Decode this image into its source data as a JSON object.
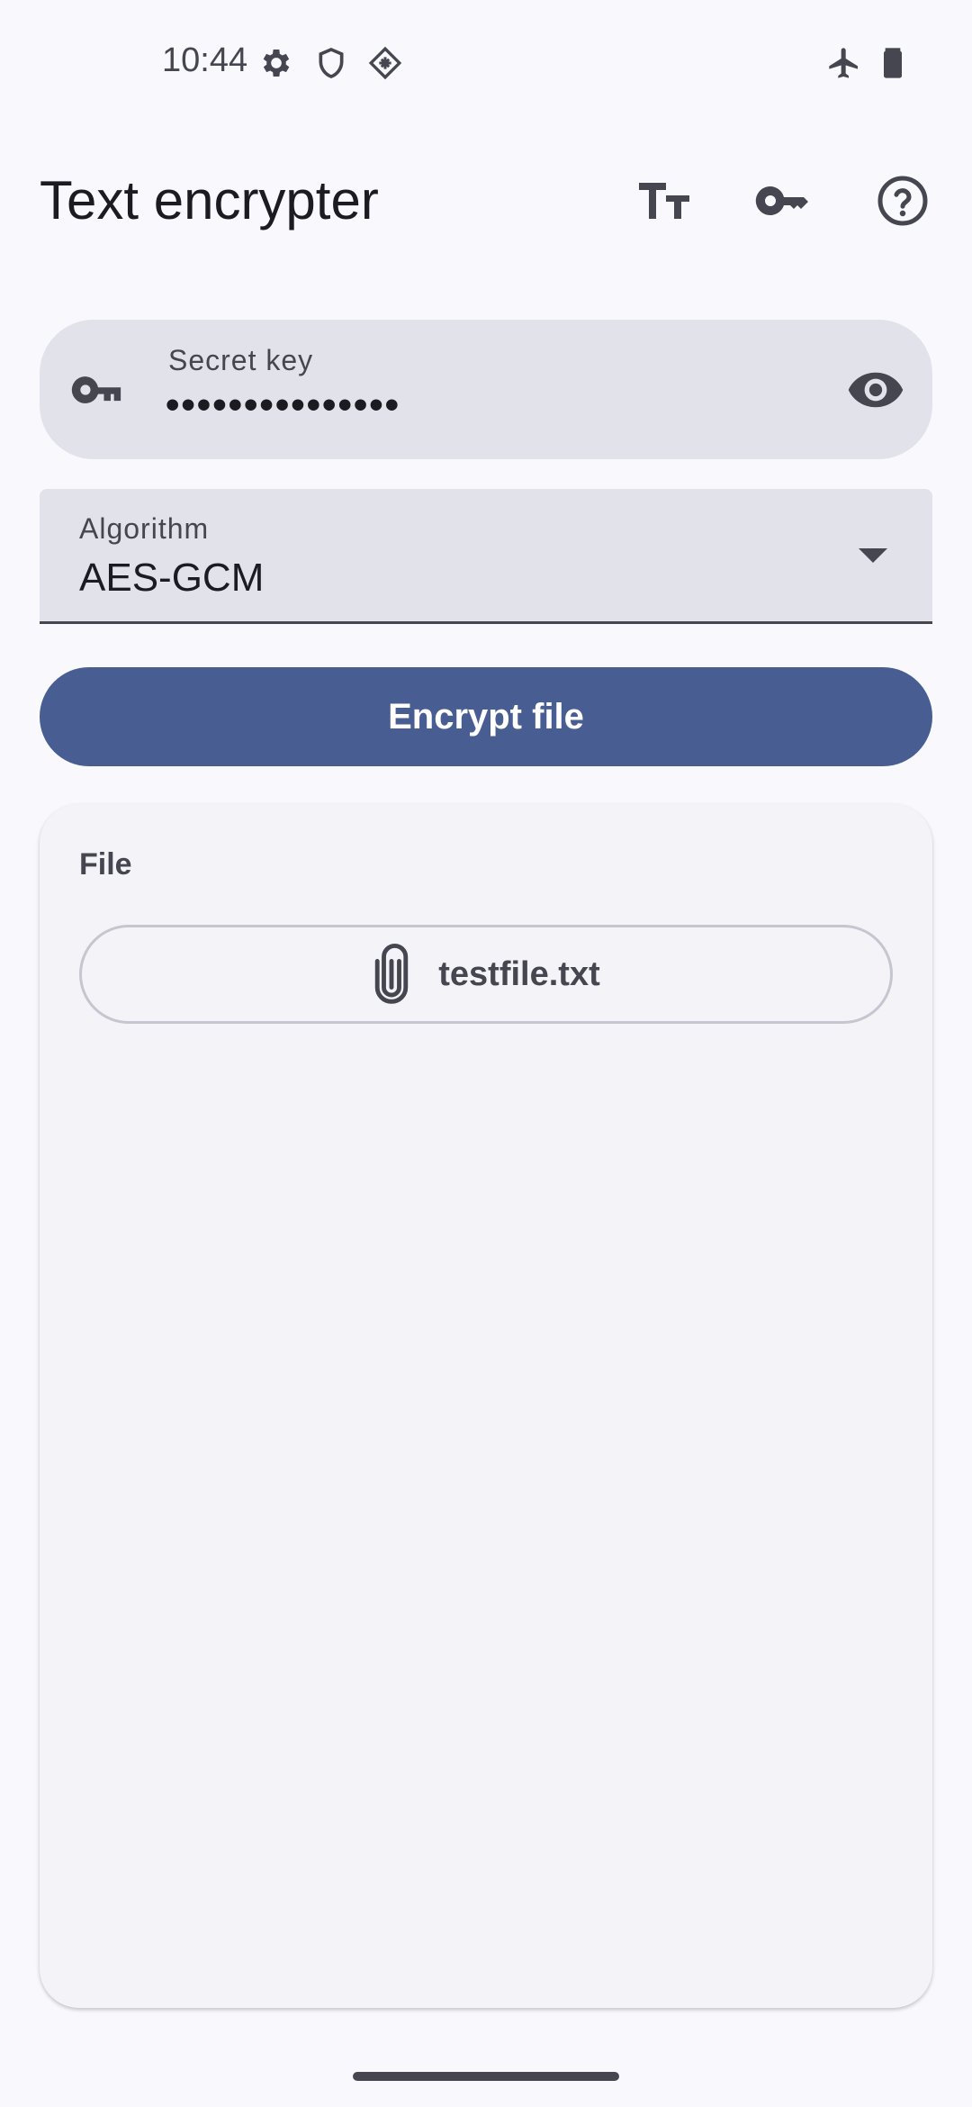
{
  "status_bar": {
    "time": "10:44",
    "left_icons": [
      "settings-icon",
      "shield-icon",
      "vpn-diamond-icon"
    ],
    "right_icons": [
      "airplane-mode-icon",
      "battery-icon"
    ]
  },
  "app_bar": {
    "title": "Text encrypter",
    "actions": [
      "text-size-icon",
      "key-icon",
      "help-icon"
    ]
  },
  "secret_key": {
    "label": "Secret key",
    "value": "•••••••••••••••",
    "leading_icon": "key-icon",
    "trailing_icon": "visibility-icon"
  },
  "algorithm": {
    "label": "Algorithm",
    "value": "AES-GCM"
  },
  "encrypt_button": {
    "label": "Encrypt file"
  },
  "file_card": {
    "title": "File",
    "file_name": "testfile.txt",
    "icon": "paperclip-icon"
  },
  "colors": {
    "background": "#f8f8fd",
    "primary": "#485e92",
    "field_bg": "#e2e2ea",
    "card_bg": "#f3f3f8",
    "on_surface": "#1b1b21",
    "on_surface_variant": "#45464f"
  }
}
